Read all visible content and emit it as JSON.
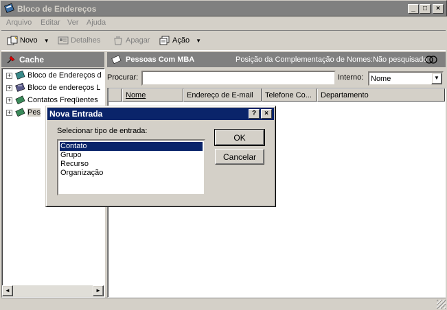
{
  "window": {
    "title": "Bloco de Endereços",
    "minimize": "_",
    "maximize": "□",
    "close": "×"
  },
  "menu": [
    "Arquivo",
    "Editar",
    "Ver",
    "Ajuda"
  ],
  "toolbar": {
    "novo": "Novo",
    "detalhes": "Detalhes",
    "apagar": "Apagar",
    "acao": "Ação"
  },
  "left_pane": {
    "title": "Cache",
    "tree": [
      "Bloco de Endereços d",
      "Bloco de endereços L",
      "Contatos Freqüentes",
      "Pes"
    ]
  },
  "right_pane": {
    "title": "Pessoas Com MBA",
    "status": "Posição da Complementação de Nomes:Não pesquisado",
    "search_label": "Procurar:",
    "search_value": "",
    "interno_label": "Interno:",
    "interno_value": "Nome",
    "columns": [
      "Nome",
      "Endereço de E-mail",
      "Telefone Co...",
      "Departamento"
    ]
  },
  "dialog": {
    "title": "Nova Entrada",
    "help": "?",
    "close": "×",
    "prompt": "Selecionar tipo de entrada:",
    "types": [
      "Contato",
      "Grupo",
      "Recurso",
      "Organização"
    ],
    "selected_index": 0,
    "ok": "OK",
    "cancel": "Cancelar"
  },
  "colors": {
    "title_active": "#0a246a",
    "title_inactive": "#808080",
    "face": "#d4d0c8"
  }
}
